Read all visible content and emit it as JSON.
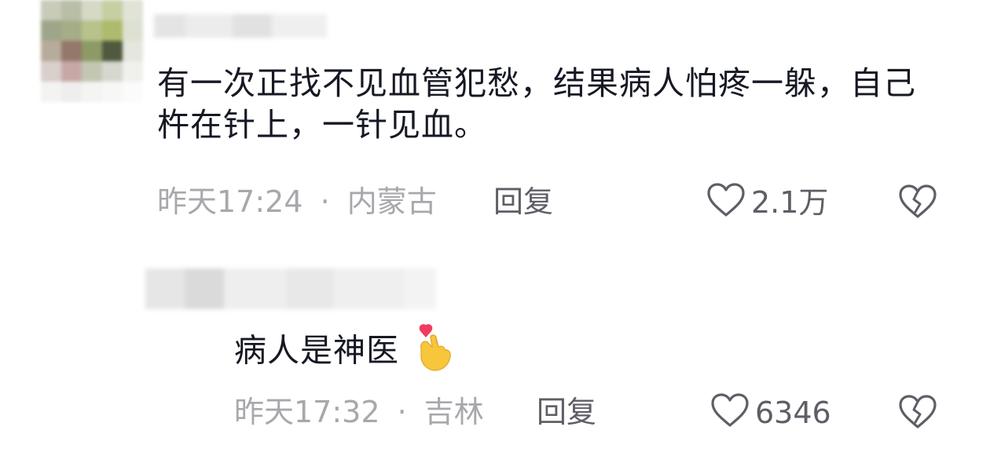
{
  "comments": [
    {
      "text": "有一次正找不见血管犯愁，结果病人怕疼一躲，自己杵在针上，一针见血。",
      "timestamp": "昨天17:24",
      "separator": "·",
      "location": "内蒙古",
      "reply_label": "回复",
      "like_count": "2.1万",
      "icons": {
        "like": "heart-outline-icon",
        "dislike": "broken-heart-icon"
      }
    }
  ],
  "replies": [
    {
      "text": "病人是神医",
      "emoji": "finger-heart-emoji",
      "timestamp": "昨天17:32",
      "separator": "·",
      "location": "吉林",
      "reply_label": "回复",
      "like_count": "6346",
      "icons": {
        "like": "heart-outline-icon",
        "dislike": "broken-heart-icon"
      }
    }
  ],
  "colors": {
    "primary_text": "#161823",
    "meta_text": "#a8a8ac",
    "action_text": "#5e5e66",
    "background": "#ffffff"
  }
}
